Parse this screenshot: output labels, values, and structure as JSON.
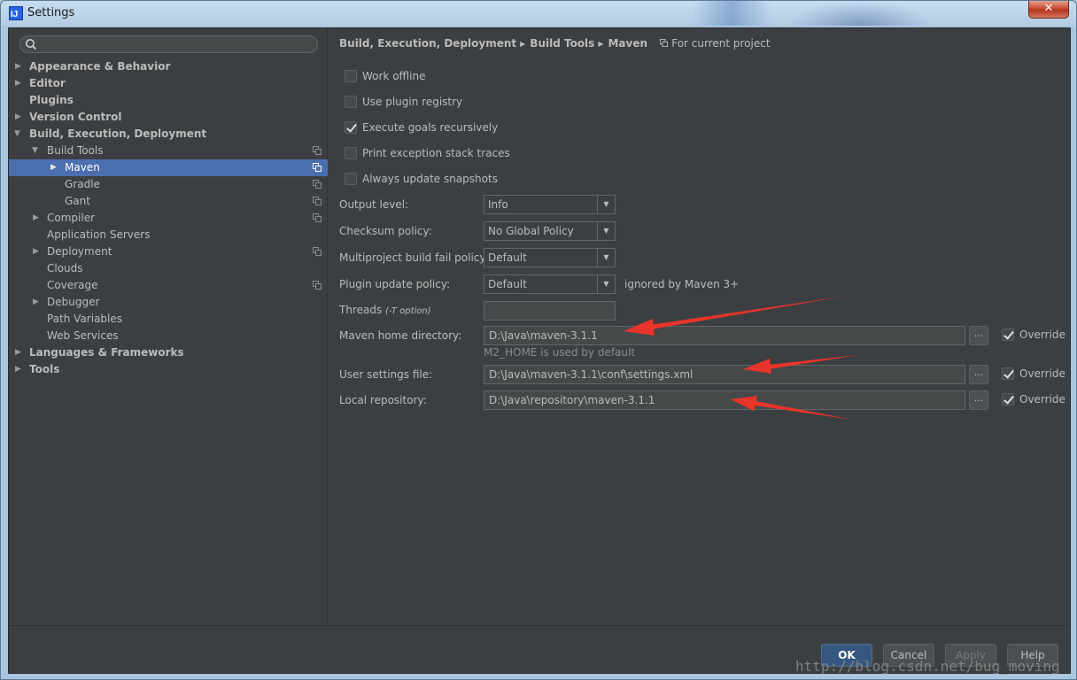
{
  "window": {
    "title": "Settings",
    "close_glyph": "✕"
  },
  "search": {
    "placeholder": "",
    "icon": "search-icon"
  },
  "sidebar": {
    "items": [
      {
        "label": "Appearance & Behavior",
        "arrow": "▶"
      },
      {
        "label": "Editor",
        "arrow": "▶"
      },
      {
        "label": "Plugins",
        "arrow": ""
      },
      {
        "label": "Version Control",
        "arrow": "▶"
      },
      {
        "label": "Build, Execution, Deployment",
        "arrow": "▼"
      },
      {
        "label": "Build Tools",
        "arrow": "▼"
      },
      {
        "label": "Maven",
        "arrow": "▶"
      },
      {
        "label": "Gradle",
        "arrow": ""
      },
      {
        "label": "Gant",
        "arrow": ""
      },
      {
        "label": "Compiler",
        "arrow": "▶"
      },
      {
        "label": "Application Servers",
        "arrow": ""
      },
      {
        "label": "Deployment",
        "arrow": "▶"
      },
      {
        "label": "Clouds",
        "arrow": ""
      },
      {
        "label": "Coverage",
        "arrow": ""
      },
      {
        "label": "Debugger",
        "arrow": "▶"
      },
      {
        "label": "Path Variables",
        "arrow": ""
      },
      {
        "label": "Web Services",
        "arrow": ""
      },
      {
        "label": "Languages & Frameworks",
        "arrow": "▶"
      },
      {
        "label": "Tools",
        "arrow": "▶"
      }
    ]
  },
  "breadcrumb": {
    "parts": [
      "Build, Execution, Deployment",
      "Build Tools",
      "Maven"
    ],
    "separator": "▶",
    "scope": "For current project"
  },
  "checkboxes": [
    {
      "label": "Work offline",
      "checked": false
    },
    {
      "label": "Use plugin registry",
      "checked": false
    },
    {
      "label": "Execute goals recursively",
      "checked": true
    },
    {
      "label": "Print exception stack traces",
      "checked": false
    },
    {
      "label": "Always update snapshots",
      "checked": false
    }
  ],
  "form": {
    "output_level": {
      "label": "Output level:",
      "value": "Info"
    },
    "checksum_policy": {
      "label": "Checksum policy:",
      "value": "No Global Policy"
    },
    "multiproject_fail_policy": {
      "label": "Multiproject build fail policy:",
      "value": "Default"
    },
    "plugin_update_policy": {
      "label": "Plugin update policy:",
      "value": "Default",
      "note": "ignored by Maven 3+"
    },
    "threads": {
      "label": "Threads",
      "hint": "(-T option)",
      "value": ""
    },
    "maven_home": {
      "label": "Maven home directory:",
      "value": "D:\\Java\\maven-3.1.1",
      "hint": "M2_HOME is used by default",
      "override": "Override",
      "override_checked": true
    },
    "user_settings": {
      "label": "User settings file:",
      "value": "D:\\Java\\maven-3.1.1\\conf\\settings.xml",
      "override": "Override",
      "override_checked": true
    },
    "local_repository": {
      "label": "Local repository:",
      "value": "D:\\Java\\repository\\maven-3.1.1",
      "override": "Override",
      "override_checked": true
    },
    "combo_arrow": "▼",
    "browse": "..."
  },
  "buttons": {
    "ok": "OK",
    "cancel": "Cancel",
    "apply": "Apply",
    "help": "Help"
  },
  "watermark": "http://blog.csdn.net/bug_moving",
  "colors": {
    "background": "#3c3f41",
    "selection": "#4b6eaf",
    "annotation_arrow": "#e8342a",
    "primary_button": "#365880"
  }
}
